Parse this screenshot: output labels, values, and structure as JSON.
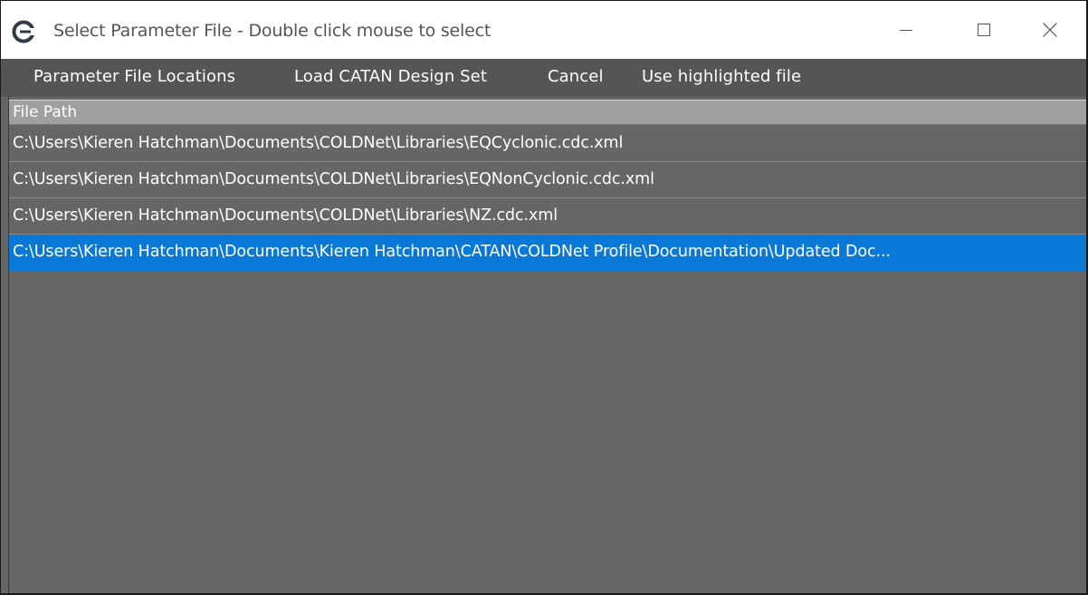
{
  "window": {
    "title": "Select Parameter File - Double click mouse to select",
    "app_icon": "catan-logo-icon",
    "controls": [
      "minimize-icon",
      "maximize-icon",
      "close-icon"
    ]
  },
  "menu": {
    "items": [
      {
        "label": "Parameter File Locations"
      },
      {
        "label": "Load CATAN Design Set"
      },
      {
        "label": "Cancel"
      },
      {
        "label": "Use highlighted file"
      }
    ]
  },
  "table": {
    "columns": [
      "File Path"
    ],
    "rows": [
      {
        "path": "C:\\Users\\Kieren Hatchman\\Documents\\COLDNet\\Libraries\\EQCyclonic.cdc.xml",
        "selected": false
      },
      {
        "path": "C:\\Users\\Kieren Hatchman\\Documents\\COLDNet\\Libraries\\EQNonCyclonic.cdc.xml",
        "selected": false
      },
      {
        "path": "C:\\Users\\Kieren Hatchman\\Documents\\COLDNet\\Libraries\\NZ.cdc.xml",
        "selected": false
      },
      {
        "path": "C:\\Users\\Kieren Hatchman\\Documents\\Kieren Hatchman\\CATAN\\COLDNet Profile\\Documentation\\Updated Doc...",
        "selected": true
      }
    ]
  },
  "colors": {
    "background": "#666666",
    "menubar": "#555555",
    "header": "#a0a0a0",
    "selection": "#0a78d7"
  }
}
